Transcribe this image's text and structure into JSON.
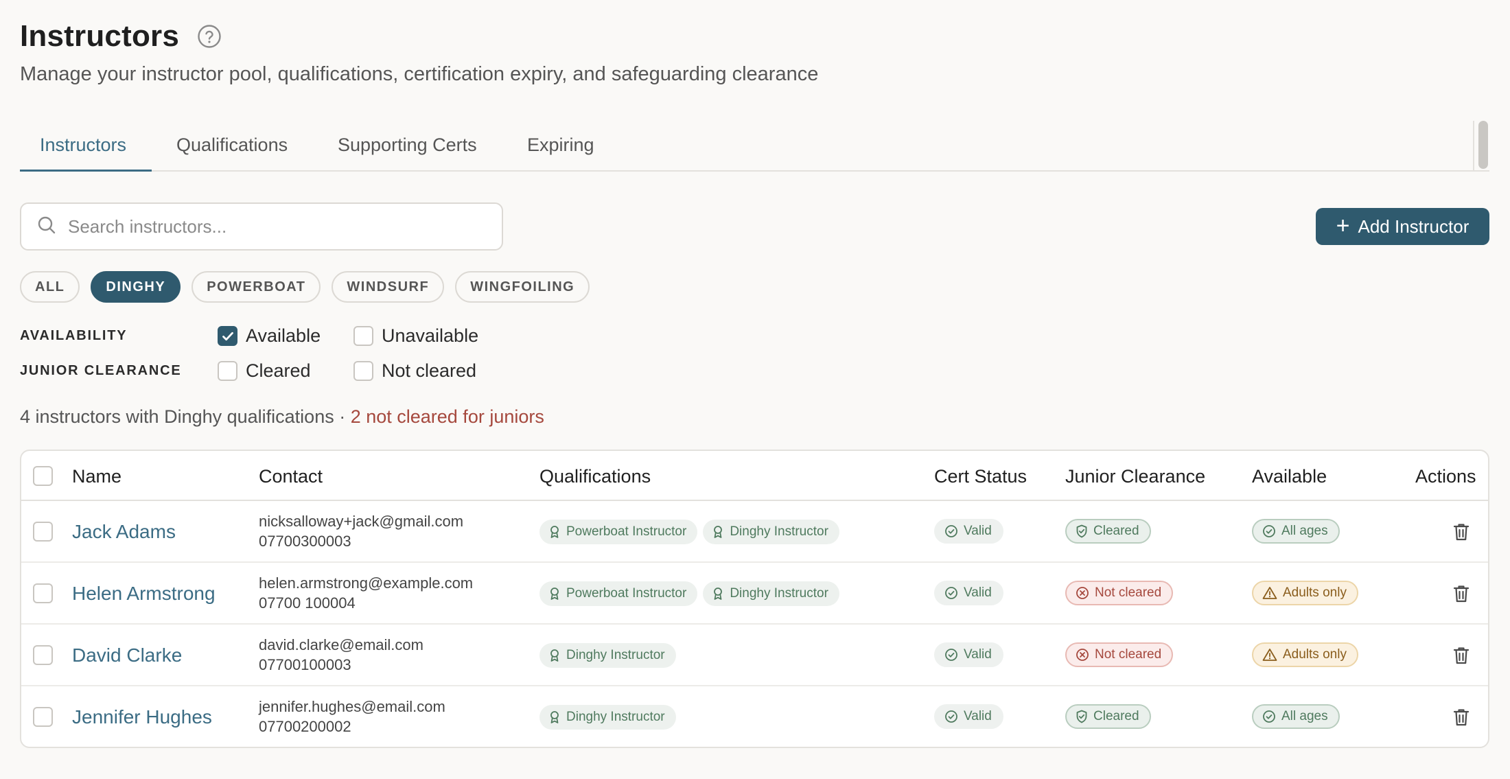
{
  "header": {
    "title": "Instructors",
    "subtitle": "Manage your instructor pool, qualifications, certification expiry, and safeguarding clearance"
  },
  "tabs": [
    {
      "label": "Instructors",
      "active": true
    },
    {
      "label": "Qualifications",
      "active": false
    },
    {
      "label": "Supporting Certs",
      "active": false
    },
    {
      "label": "Expiring",
      "active": false
    }
  ],
  "search": {
    "placeholder": "Search instructors...",
    "value": ""
  },
  "add_button": {
    "label": "Add Instructor"
  },
  "categories": [
    {
      "label": "ALL",
      "active": false
    },
    {
      "label": "DINGHY",
      "active": true
    },
    {
      "label": "POWERBOAT",
      "active": false
    },
    {
      "label": "WINDSURF",
      "active": false
    },
    {
      "label": "WINGFOILING",
      "active": false
    }
  ],
  "filters": {
    "availability": {
      "label": "AVAILABILITY",
      "options": [
        {
          "label": "Available",
          "checked": true
        },
        {
          "label": "Unavailable",
          "checked": false
        }
      ]
    },
    "junior_clearance": {
      "label": "JUNIOR CLEARANCE",
      "options": [
        {
          "label": "Cleared",
          "checked": false
        },
        {
          "label": "Not cleared",
          "checked": false
        }
      ]
    }
  },
  "summary": {
    "text": "4 instructors with Dinghy qualifications · ",
    "warning": "2 not cleared for juniors"
  },
  "table": {
    "columns": [
      "Name",
      "Contact",
      "Qualifications",
      "Cert Status",
      "Junior Clearance",
      "Available",
      "Actions"
    ],
    "rows": [
      {
        "name": "Jack Adams",
        "email": "nicksalloway+jack@gmail.com",
        "phone": "07700300003",
        "qualifications": [
          "Powerboat Instructor",
          "Dinghy Instructor"
        ],
        "cert_status": "Valid",
        "junior_clearance": "Cleared",
        "available": "All ages"
      },
      {
        "name": "Helen Armstrong",
        "email": "helen.armstrong@example.com",
        "phone": "07700 100004",
        "qualifications": [
          "Powerboat Instructor",
          "Dinghy Instructor"
        ],
        "cert_status": "Valid",
        "junior_clearance": "Not cleared",
        "available": "Adults only"
      },
      {
        "name": "David Clarke",
        "email": "david.clarke@email.com",
        "phone": "07700100003",
        "qualifications": [
          "Dinghy Instructor"
        ],
        "cert_status": "Valid",
        "junior_clearance": "Not cleared",
        "available": "Adults only"
      },
      {
        "name": "Jennifer Hughes",
        "email": "jennifer.hughes@email.com",
        "phone": "07700200002",
        "qualifications": [
          "Dinghy Instructor"
        ],
        "cert_status": "Valid",
        "junior_clearance": "Cleared",
        "available": "All ages"
      }
    ]
  },
  "colors": {
    "accent": "#2f5a6e",
    "link": "#3b6c84",
    "warning_text": "#a5483d",
    "success": "#4f7a5e",
    "caution": "#8a5d1c"
  },
  "icons": {
    "help": "question-circle-icon",
    "search": "search-icon",
    "add": "plus-icon",
    "qualification": "award-icon",
    "valid": "check-circle-icon",
    "cleared": "shield-check-icon",
    "not_cleared": "x-circle-icon",
    "adults_only": "warning-triangle-icon",
    "all_ages": "check-circle-icon",
    "delete": "trash-icon"
  }
}
